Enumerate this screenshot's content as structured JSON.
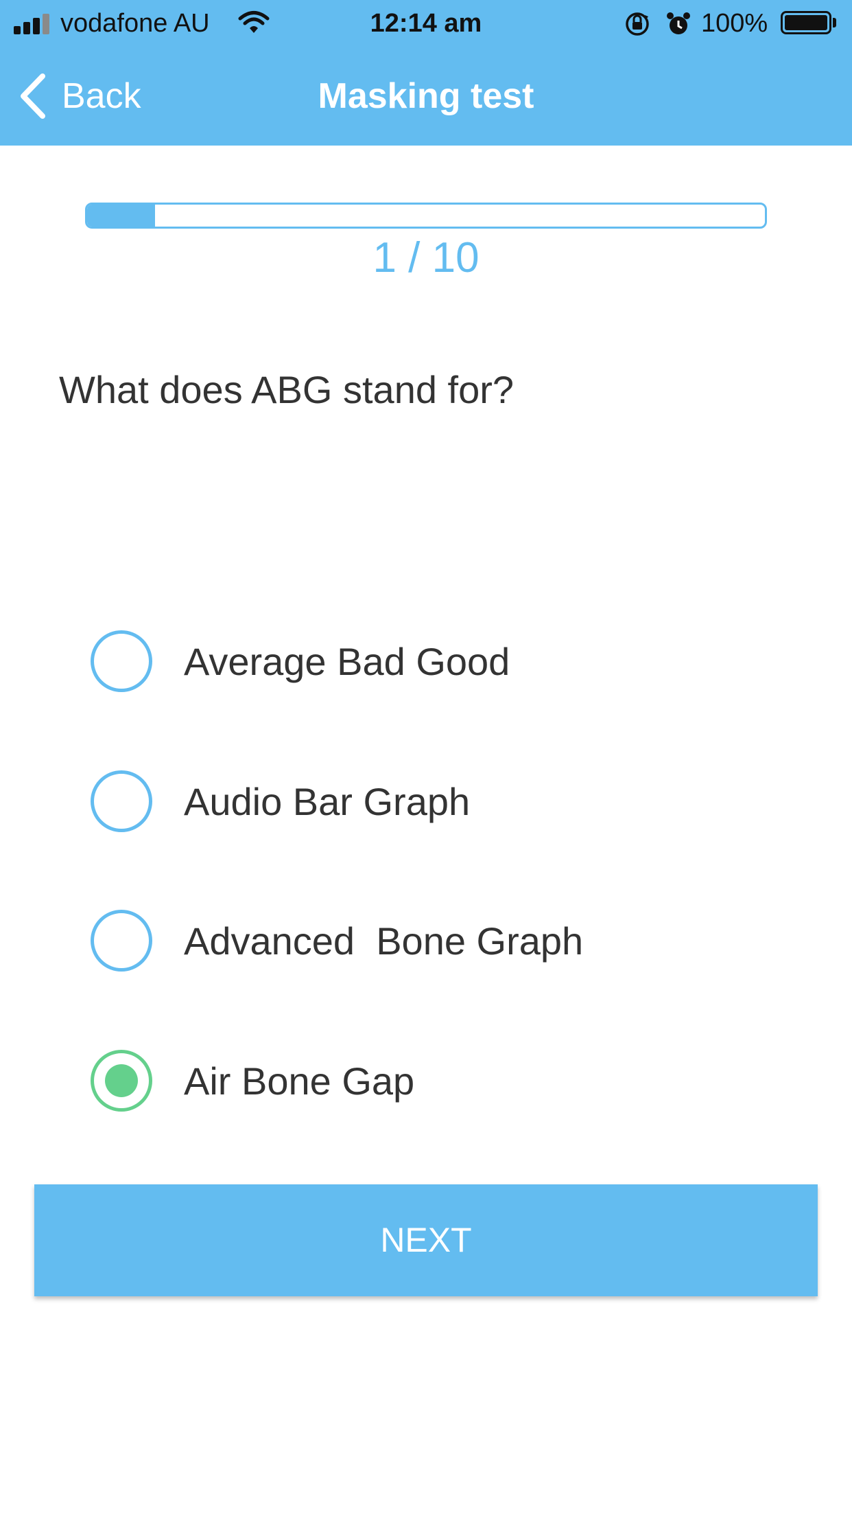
{
  "status_bar": {
    "carrier": "vodafone AU",
    "time": "12:14 am",
    "battery_percent": "100%",
    "icons": [
      "signal-icon",
      "wifi-icon",
      "rotation-lock-icon",
      "alarm-icon",
      "battery-icon"
    ]
  },
  "nav": {
    "back_label": "Back",
    "title": "Masking test"
  },
  "progress": {
    "label": "1 / 10",
    "current": 1,
    "total": 10
  },
  "question": "What does ABG stand for?",
  "options": [
    {
      "label": "Average Bad Good",
      "selected": false
    },
    {
      "label": "Audio Bar Graph",
      "selected": false
    },
    {
      "label": "Advanced  Bone Graph",
      "selected": false
    },
    {
      "label": "Air Bone Gap",
      "selected": true
    }
  ],
  "next_label": "NEXT",
  "colors": {
    "accent": "#63bcf0",
    "selected": "#64d08c",
    "text": "#333333"
  }
}
